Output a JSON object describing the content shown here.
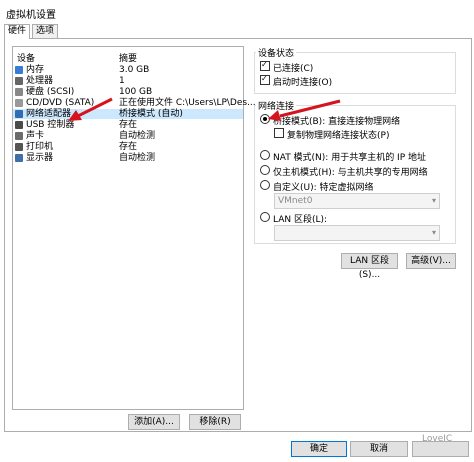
{
  "window": {
    "title": "虚拟机设置"
  },
  "tabs": [
    {
      "label": "硬件"
    },
    {
      "label": "选项"
    }
  ],
  "device_list": {
    "headers": {
      "device": "设备",
      "summary": "摘要"
    },
    "rows": [
      {
        "name": "内存",
        "summary": "3.0 GB",
        "icon": "memory-icon",
        "color": "#3a7bd5"
      },
      {
        "name": "处理器",
        "summary": "1",
        "icon": "processor-icon",
        "color": "#666666"
      },
      {
        "name": "硬盘 (SCSI)",
        "summary": "100 GB",
        "icon": "hard-disk-icon",
        "color": "#888888"
      },
      {
        "name": "CD/DVD (SATA)",
        "summary": "正在使用文件 C:\\Users\\LP\\Des...",
        "icon": "cd-dvd-icon",
        "color": "#999999"
      },
      {
        "name": "网络适配器",
        "summary": "桥接模式 (自动)",
        "icon": "network-adapter-icon",
        "color": "#2e6db4",
        "selected": true
      },
      {
        "name": "USB 控制器",
        "summary": "存在",
        "icon": "usb-controller-icon",
        "color": "#4a4a4a"
      },
      {
        "name": "声卡",
        "summary": "自动检测",
        "icon": "sound-card-icon",
        "color": "#6b6b6b"
      },
      {
        "name": "打印机",
        "summary": "存在",
        "icon": "printer-icon",
        "color": "#555555"
      },
      {
        "name": "显示器",
        "summary": "自动检测",
        "icon": "display-icon",
        "color": "#3f6fa8"
      }
    ],
    "add_label": "添加(A)...",
    "remove_label": "移除(R)"
  },
  "device_status": {
    "title": "设备状态",
    "connected": "已连接(C)",
    "connect_on_power": "启动时连接(O)"
  },
  "network": {
    "title": "网络连接",
    "bridged": "桥接模式(B): 直接连接物理网络",
    "replicate": "复制物理网络连接状态(P)",
    "nat": "NAT 模式(N): 用于共享主机的 IP 地址",
    "hostonly": "仅主机模式(H): 与主机共享的专用网络",
    "custom": "自定义(U): 特定虚拟网络",
    "vmnet_value": "VMnet0",
    "lan": "LAN 区段(L):",
    "lan_value": ""
  },
  "buttons": {
    "lan_segments": "LAN 区段(S)...",
    "advanced": "高级(V)...",
    "ok": "确定",
    "cancel": "取消"
  },
  "watermark": "LoveIC",
  "colors": {
    "selection": "#cce8ff",
    "arrow": "#d4141e",
    "accent": "#0078d7"
  }
}
